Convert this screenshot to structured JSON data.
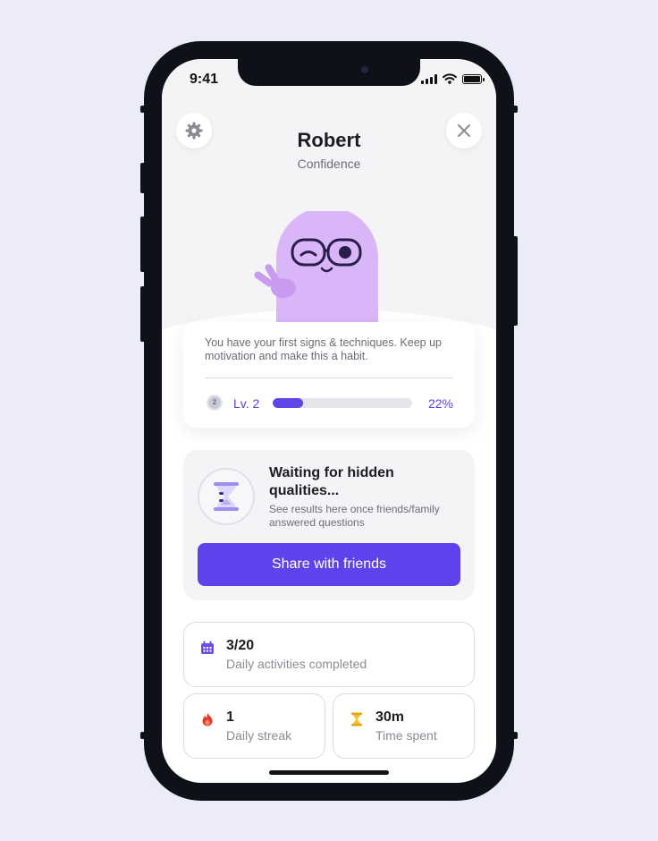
{
  "status_bar": {
    "time": "9:41"
  },
  "header": {
    "name": "Robert",
    "subtitle": "Confidence"
  },
  "level_card": {
    "message": "You have your first signs & techniques. Keep up motivation and make this a habit.",
    "badge_number": "2",
    "level_label": "Lv. 2",
    "progress": 0.22,
    "progress_text": "22%"
  },
  "hidden_card": {
    "title": "Waiting for hidden qualities...",
    "description": "See results here once friends/family answered questions",
    "button_label": "Share with friends"
  },
  "stats": {
    "activities": {
      "value": "3/20",
      "label": "Daily activities completed",
      "icon": "calendar-icon"
    },
    "streak": {
      "value": "1",
      "label": "Daily streak",
      "icon": "flame-icon"
    },
    "time": {
      "value": "30m",
      "label": "Time spent",
      "icon": "hourglass-icon"
    }
  },
  "colors": {
    "accent": "#6042ec",
    "mascot": "#d8b6f7",
    "background": "#ecebfa"
  }
}
